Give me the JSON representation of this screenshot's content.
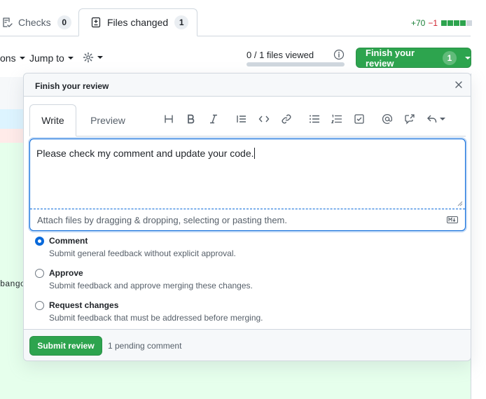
{
  "tabs": {
    "checks": {
      "label": "Checks",
      "count": "0"
    },
    "files_changed": {
      "label": "Files changed",
      "count": "1"
    }
  },
  "diffstat": {
    "additions": "+70",
    "deletions": "−1",
    "squares_on": 4,
    "squares_off": 1
  },
  "toolbar": {
    "options_label": "ons",
    "jump_to_label": "Jump to",
    "files_viewed": "0 / 1 files viewed",
    "files_viewed_fraction": 0,
    "finish_review_label": "Finish your review",
    "finish_review_count": "1"
  },
  "background": {
    "snippet": "bangoo"
  },
  "popover": {
    "title": "Finish your review",
    "editor": {
      "write_tab": "Write",
      "preview_tab": "Preview",
      "toolbar_icons": [
        "heading-icon",
        "bold-icon",
        "italic-icon",
        "quote-icon",
        "code-icon",
        "link-icon",
        "unordered-list-icon",
        "ordered-list-icon",
        "task-list-icon",
        "mention-icon",
        "cross-reference-icon",
        "saved-reply-icon"
      ],
      "value": "Please check my comment and update your code.",
      "attach_hint": "Attach files by dragging & dropping, selecting or pasting them."
    },
    "options": [
      {
        "label": "Comment",
        "description": "Submit general feedback without explicit approval.",
        "selected": true
      },
      {
        "label": "Approve",
        "description": "Submit feedback and approve merging these changes.",
        "selected": false
      },
      {
        "label": "Request changes",
        "description": "Submit feedback that must be addressed before merging.",
        "selected": false
      }
    ],
    "submit_label": "Submit review",
    "pending_text": "1 pending comment"
  },
  "colors": {
    "primary_green": "#2da44e",
    "focus_blue": "#0969da",
    "added_bg": "#e6ffec",
    "deleted_bg": "#ffebe9"
  }
}
